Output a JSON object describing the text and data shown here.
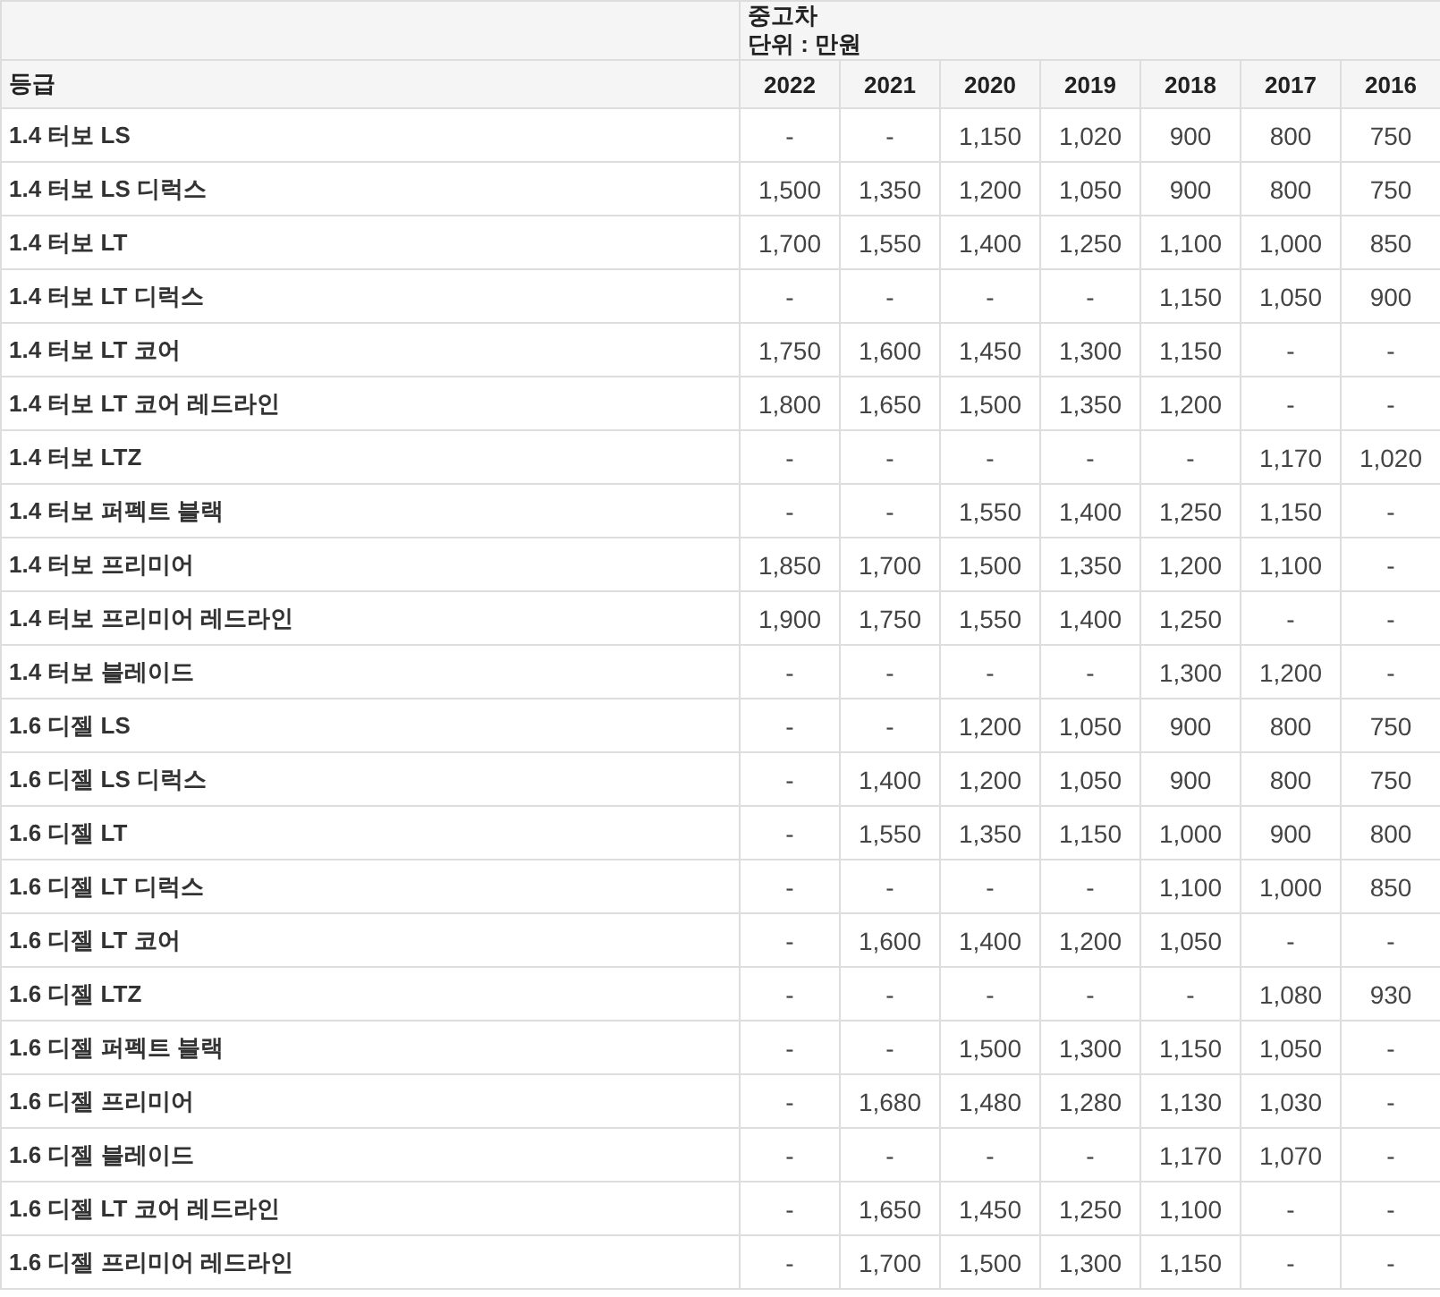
{
  "table": {
    "group_header": {
      "title": "중고차",
      "unit": "단위 : 만원"
    },
    "columns": [
      "등급",
      "2022",
      "2021",
      "2020",
      "2019",
      "2018",
      "2017",
      "2016"
    ],
    "rows": [
      {
        "grade": "1.4 터보 LS",
        "values": [
          "-",
          "-",
          "1,150",
          "1,020",
          "900",
          "800",
          "750"
        ]
      },
      {
        "grade": "1.4 터보 LS 디럭스",
        "values": [
          "1,500",
          "1,350",
          "1,200",
          "1,050",
          "900",
          "800",
          "750"
        ]
      },
      {
        "grade": "1.4 터보 LT",
        "values": [
          "1,700",
          "1,550",
          "1,400",
          "1,250",
          "1,100",
          "1,000",
          "850"
        ]
      },
      {
        "grade": "1.4 터보 LT 디럭스",
        "values": [
          "-",
          "-",
          "-",
          "-",
          "1,150",
          "1,050",
          "900"
        ]
      },
      {
        "grade": "1.4 터보 LT 코어",
        "values": [
          "1,750",
          "1,600",
          "1,450",
          "1,300",
          "1,150",
          "-",
          "-"
        ]
      },
      {
        "grade": "1.4 터보 LT 코어 레드라인",
        "values": [
          "1,800",
          "1,650",
          "1,500",
          "1,350",
          "1,200",
          "-",
          "-"
        ]
      },
      {
        "grade": "1.4 터보 LTZ",
        "values": [
          "-",
          "-",
          "-",
          "-",
          "-",
          "1,170",
          "1,020"
        ]
      },
      {
        "grade": "1.4 터보 퍼펙트 블랙",
        "values": [
          "-",
          "-",
          "1,550",
          "1,400",
          "1,250",
          "1,150",
          "-"
        ]
      },
      {
        "grade": "1.4 터보 프리미어",
        "values": [
          "1,850",
          "1,700",
          "1,500",
          "1,350",
          "1,200",
          "1,100",
          "-"
        ]
      },
      {
        "grade": "1.4 터보 프리미어 레드라인",
        "values": [
          "1,900",
          "1,750",
          "1,550",
          "1,400",
          "1,250",
          "-",
          "-"
        ]
      },
      {
        "grade": "1.4 터보 블레이드",
        "values": [
          "-",
          "-",
          "-",
          "-",
          "1,300",
          "1,200",
          "-"
        ]
      },
      {
        "grade": "1.6 디젤 LS",
        "values": [
          "-",
          "-",
          "1,200",
          "1,050",
          "900",
          "800",
          "750"
        ]
      },
      {
        "grade": "1.6 디젤 LS 디럭스",
        "values": [
          "-",
          "1,400",
          "1,200",
          "1,050",
          "900",
          "800",
          "750"
        ]
      },
      {
        "grade": "1.6 디젤 LT",
        "values": [
          "-",
          "1,550",
          "1,350",
          "1,150",
          "1,000",
          "900",
          "800"
        ]
      },
      {
        "grade": "1.6 디젤 LT 디럭스",
        "values": [
          "-",
          "-",
          "-",
          "-",
          "1,100",
          "1,000",
          "850"
        ]
      },
      {
        "grade": "1.6 디젤 LT 코어",
        "values": [
          "-",
          "1,600",
          "1,400",
          "1,200",
          "1,050",
          "-",
          "-"
        ]
      },
      {
        "grade": "1.6 디젤 LTZ",
        "values": [
          "-",
          "-",
          "-",
          "-",
          "-",
          "1,080",
          "930"
        ]
      },
      {
        "grade": "1.6 디젤 퍼펙트 블랙",
        "values": [
          "-",
          "-",
          "1,500",
          "1,300",
          "1,150",
          "1,050",
          "-"
        ]
      },
      {
        "grade": "1.6 디젤 프리미어",
        "values": [
          "-",
          "1,680",
          "1,480",
          "1,280",
          "1,130",
          "1,030",
          "-"
        ]
      },
      {
        "grade": "1.6 디젤 블레이드",
        "values": [
          "-",
          "-",
          "-",
          "-",
          "1,170",
          "1,070",
          "-"
        ]
      },
      {
        "grade": "1.6 디젤 LT 코어 레드라인",
        "values": [
          "-",
          "1,650",
          "1,450",
          "1,250",
          "1,100",
          "-",
          "-"
        ]
      },
      {
        "grade": "1.6 디젤 프리미어 레드라인",
        "values": [
          "-",
          "1,700",
          "1,500",
          "1,300",
          "1,150",
          "-",
          "-"
        ]
      }
    ]
  }
}
